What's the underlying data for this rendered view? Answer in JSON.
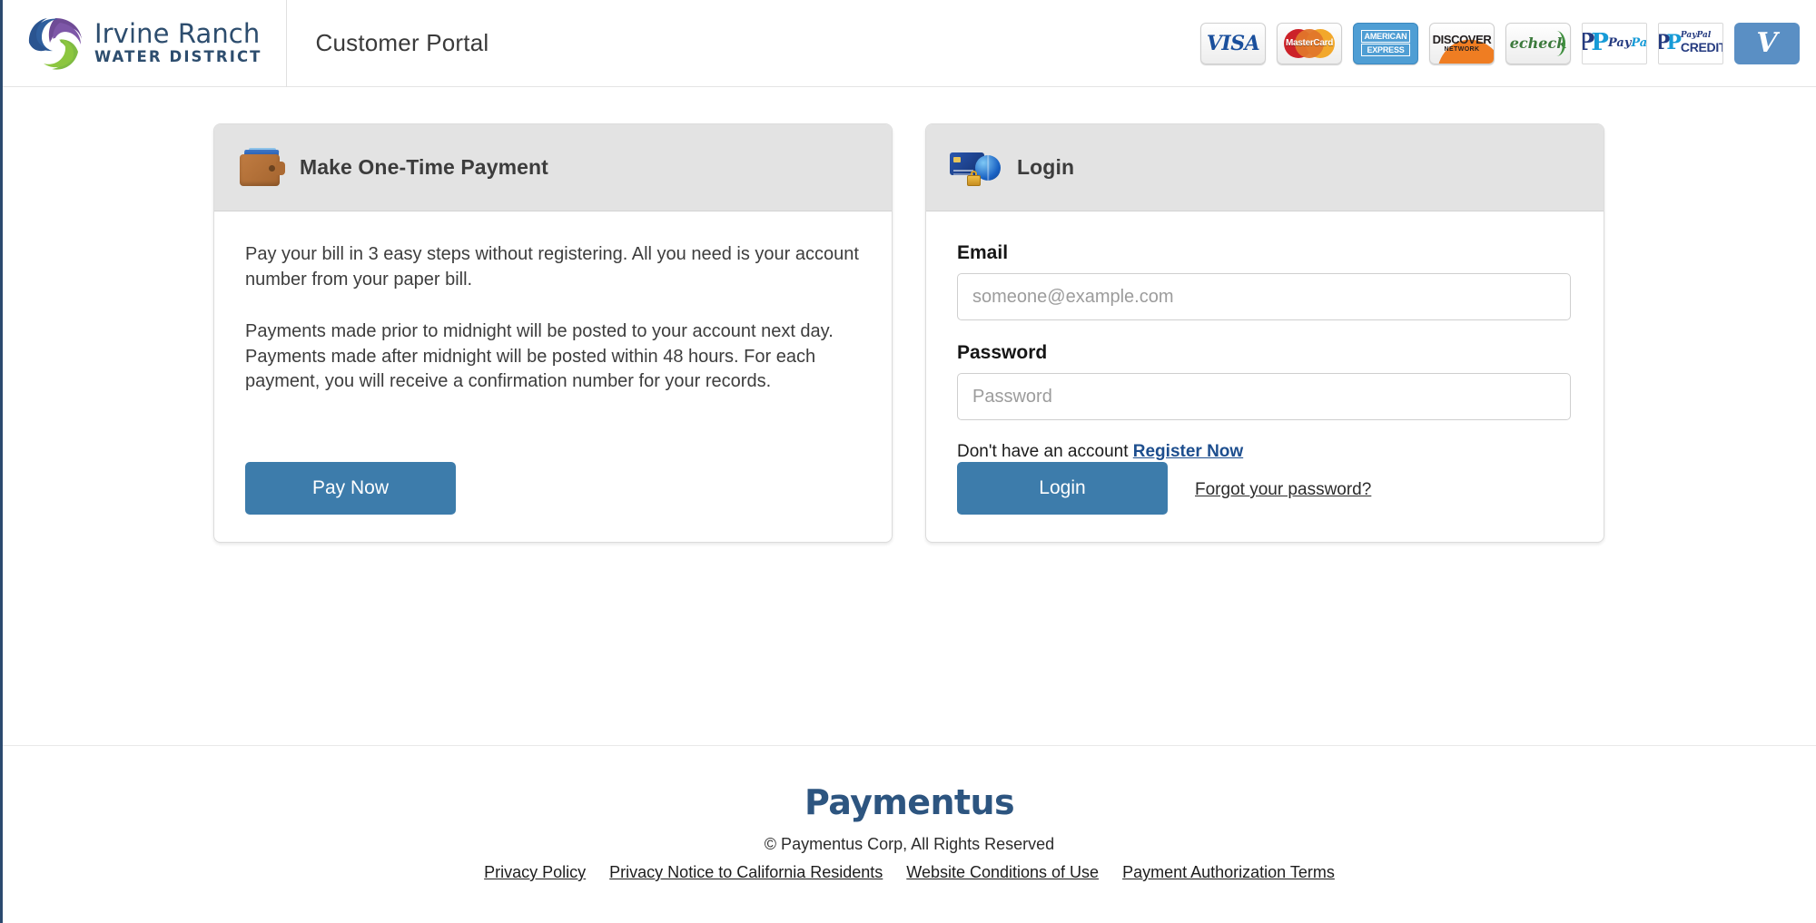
{
  "header": {
    "logo": {
      "icon": "irwd-pinwheel-logo",
      "line1": "Irvine Ranch",
      "line2": "WATER DISTRICT"
    },
    "portal_title": "Customer Portal",
    "payment_methods": [
      {
        "name": "visa",
        "label": "VISA"
      },
      {
        "name": "mastercard",
        "label": "MasterCard"
      },
      {
        "name": "american-express",
        "label_top": "AMERICAN",
        "label_bottom": "EXPRESS"
      },
      {
        "name": "discover",
        "label_top": "DISCOVER",
        "label_bottom": "NETWORK"
      },
      {
        "name": "echeck",
        "label": "echeck"
      },
      {
        "name": "paypal",
        "label_a": "Pay",
        "label_b": "Pal"
      },
      {
        "name": "paypal-credit",
        "label_top_a": "PayPal",
        "label_bottom": "CREDIT"
      },
      {
        "name": "venmo",
        "label": "V"
      }
    ]
  },
  "one_time_payment": {
    "icon": "wallet-icon",
    "title": "Make One-Time Payment",
    "paragraph1": "Pay your bill in 3 easy steps without registering. All you need is your account number from your paper bill.",
    "paragraph2": "Payments made prior to midnight will be posted to your account next day. Payments made after midnight will be posted within 48 hours. For each payment, you will receive a confirmation number for your records.",
    "pay_button": "Pay Now"
  },
  "login": {
    "icon": "secure-card-globe-lock-icon",
    "title": "Login",
    "email_label": "Email",
    "email_placeholder": "someone@example.com",
    "email_value": "",
    "password_label": "Password",
    "password_placeholder": "Password",
    "password_value": "",
    "register_prompt": "Don't have an account ",
    "register_link": "Register Now",
    "login_button": "Login",
    "forgot_link": "Forgot your password?"
  },
  "footer": {
    "brand": "Paymentus",
    "copyright": "© Paymentus Corp, All Rights Reserved",
    "links": [
      "Privacy Policy ",
      "Privacy Notice to California Residents ",
      "Website Conditions of Use ",
      "Payment Authorization Terms"
    ]
  },
  "colors": {
    "accent_blue": "#3d7cab",
    "brand_navy": "#2d4d6e",
    "link_blue": "#1d4e8e",
    "card_header_gray": "#e3e3e3",
    "paymentus_blue": "#2d5580"
  }
}
